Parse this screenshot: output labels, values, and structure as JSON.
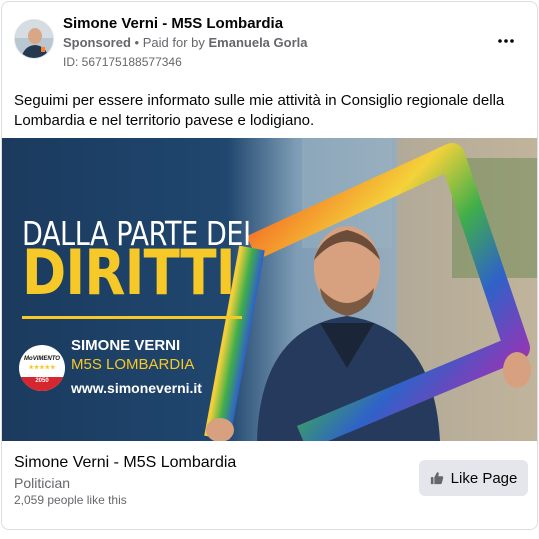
{
  "header": {
    "page_name": "Simone Verni - M5S Lombardia",
    "sponsored_label": "Sponsored",
    "separator": "•",
    "paid_prefix": "Paid for by",
    "paid_by": "Emanuela Gorla",
    "ad_id": "ID: 567175188577346",
    "more_icon": "more-horizontal-icon"
  },
  "post": {
    "text": "Seguimi per essere informato sulle mie attività in Consiglio regionale della Lombardia e nel territorio pavese e lodigiano."
  },
  "image": {
    "title_line1": "DALLA PARTE DEI",
    "title_line2": "DIRITTI",
    "candidate_name": "SIMONE VERNI",
    "candidate_sub": "M5S LOMBARDIA",
    "url": "www.simoneverni.it",
    "logo_word": "MoVIMENTO",
    "logo_stars": "★★★★★",
    "logo_year": "2050"
  },
  "footer": {
    "name": "Simone Verni - M5S Lombardia",
    "category": "Politician",
    "likes": "2,059 people like this",
    "like_button": "Like Page"
  },
  "colors": {
    "accent_yellow": "#f7c928",
    "brand_blue": "#1f3f63",
    "button_bg": "#e4e6eb",
    "secondary_text": "#65676b"
  }
}
